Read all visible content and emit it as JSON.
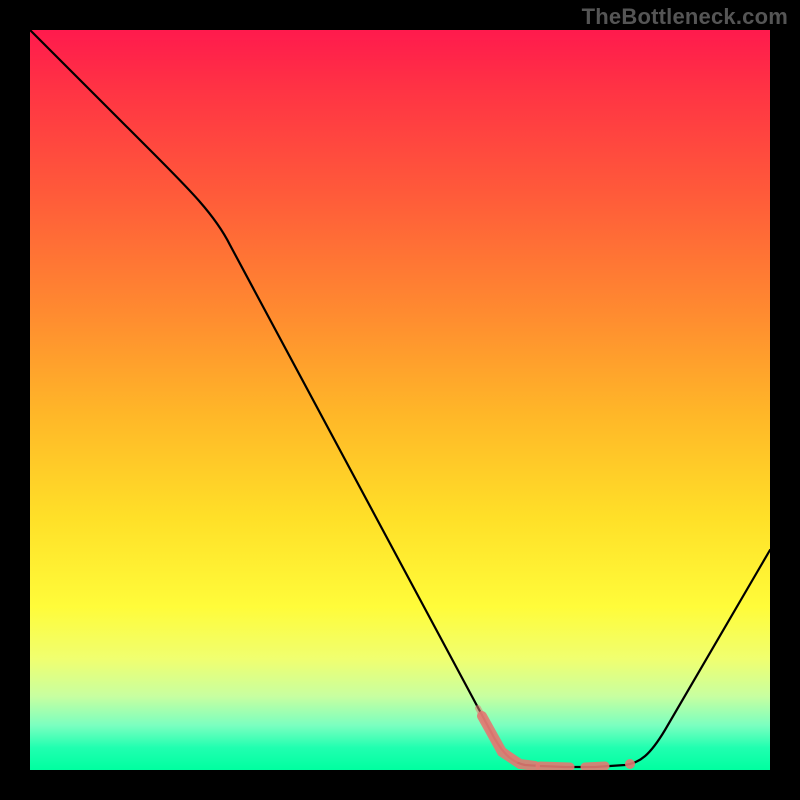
{
  "watermark": "TheBottleneck.com",
  "chart_data": {
    "type": "line",
    "title": "",
    "xlabel": "",
    "ylabel": "",
    "xlim": [
      0,
      100
    ],
    "ylim": [
      0,
      100
    ],
    "x": [
      0,
      5,
      10,
      15,
      20,
      25,
      30,
      35,
      40,
      45,
      50,
      55,
      60,
      62,
      65,
      68,
      70,
      72,
      75,
      78,
      80,
      85,
      90,
      95,
      100
    ],
    "values": [
      100,
      95,
      89,
      84,
      79,
      73,
      62,
      52,
      42,
      32,
      22,
      12,
      5,
      3,
      1,
      0.5,
      0.5,
      0.5,
      0.5,
      0.5,
      2,
      8,
      15,
      22,
      30
    ],
    "highlight_region": {
      "x_start": 58,
      "x_end": 78,
      "style": "salmon-dashed"
    },
    "background_gradient": {
      "top": "#ff1a4d",
      "bottom": "#00ffa0"
    }
  }
}
